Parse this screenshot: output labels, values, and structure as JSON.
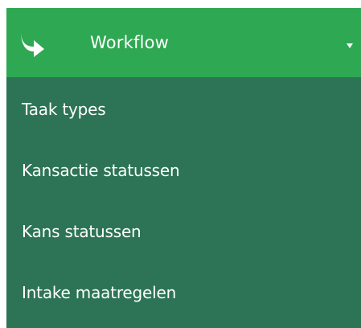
{
  "menu": {
    "header": {
      "label": "Workflow",
      "icon": "share-arrow-icon",
      "caret": "caret-down-icon"
    },
    "items": [
      {
        "label": "Taak types"
      },
      {
        "label": "Kansactie statussen"
      },
      {
        "label": "Kans statussen"
      },
      {
        "label": "Intake maatregelen"
      }
    ]
  },
  "colors": {
    "header_bg": "#2ea852",
    "panel_bg": "#2c7455",
    "text": "#ffffff"
  }
}
